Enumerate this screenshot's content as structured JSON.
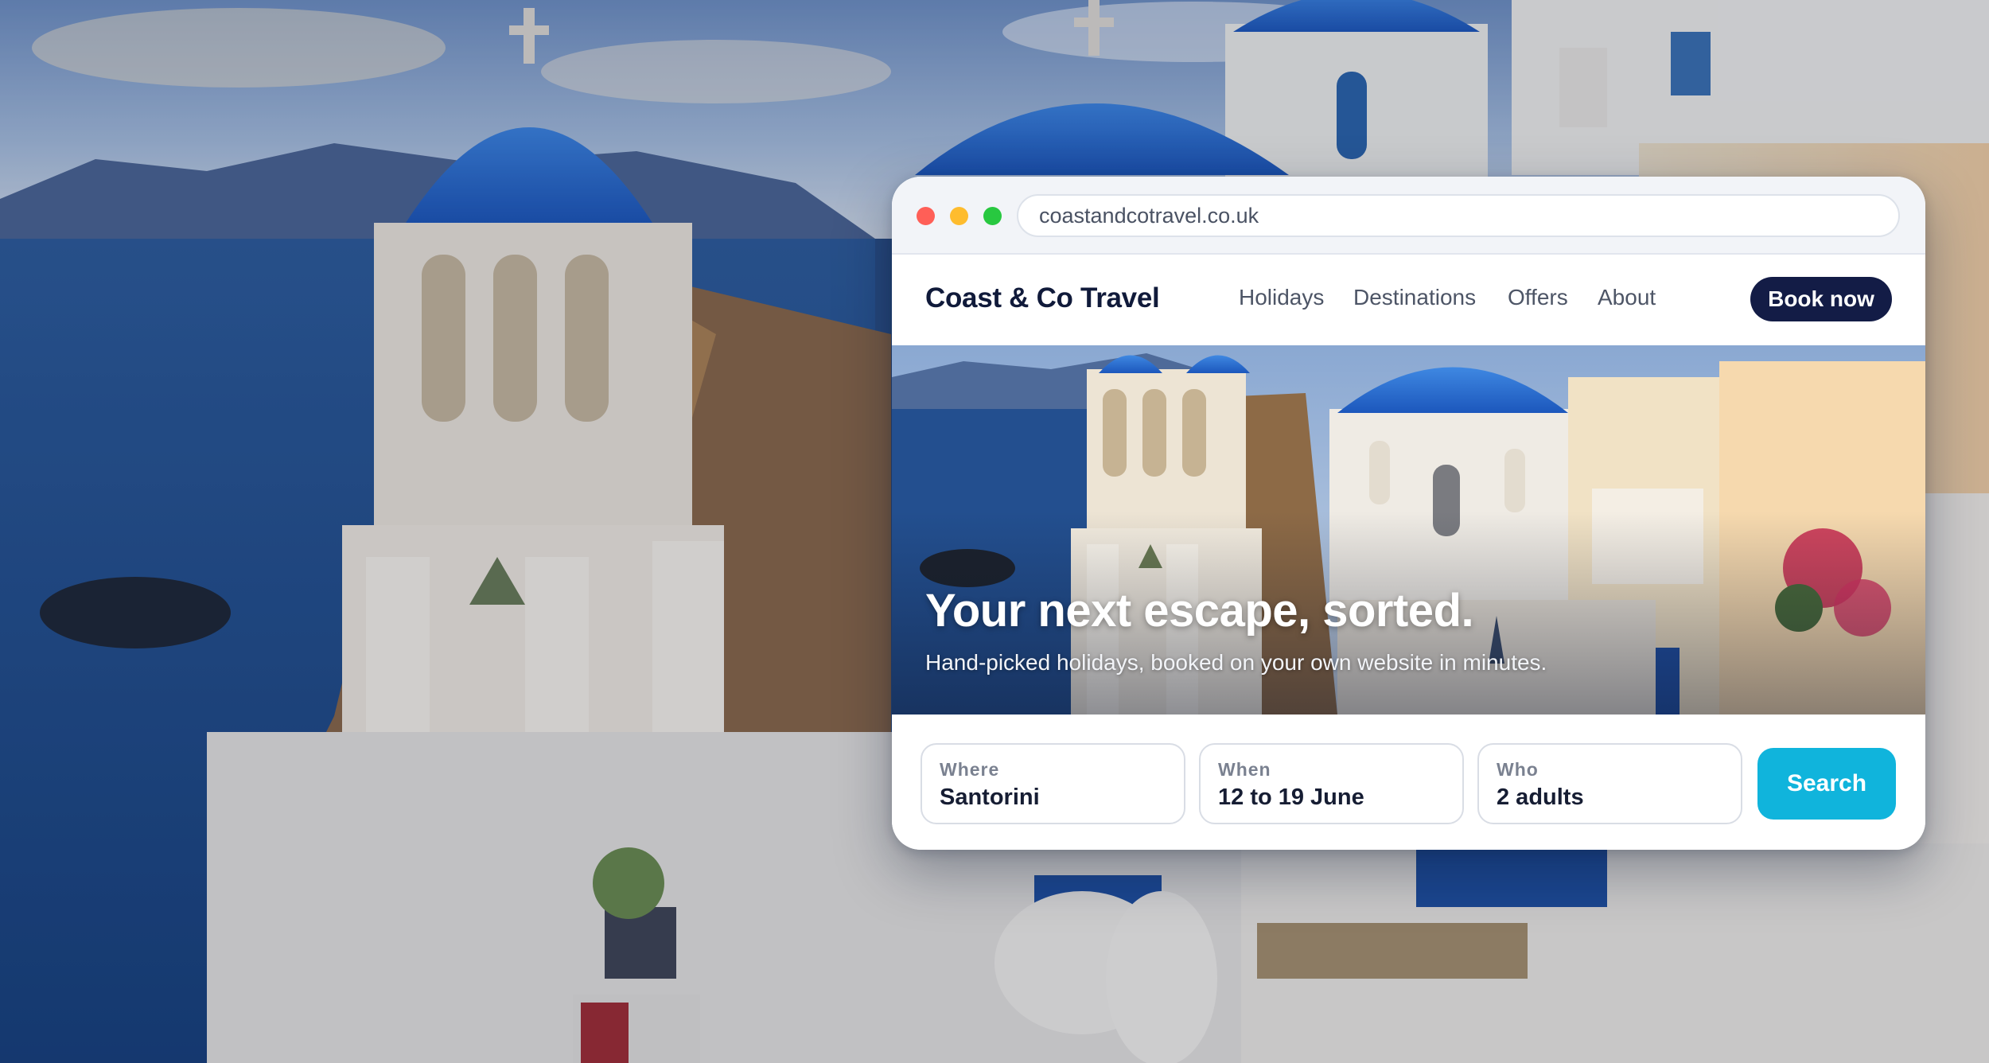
{
  "browser": {
    "address": "coastandcotravel.co.uk"
  },
  "nav": {
    "brand": "Coast & Co Travel",
    "links": [
      "Holidays",
      "Destinations",
      "Offers",
      "About"
    ],
    "cta": "Book now"
  },
  "hero": {
    "title": "Your next escape, sorted.",
    "subtitle": "Hand-picked holidays, booked on your own website in minutes."
  },
  "search": {
    "fields": [
      {
        "label": "Where",
        "value": "Santorini"
      },
      {
        "label": "When",
        "value": "12 to 19 June"
      },
      {
        "label": "Who",
        "value": "2 adults"
      }
    ],
    "button": "Search"
  },
  "colors": {
    "brand_navy": "#131c46",
    "accent_cyan": "#10b4dc",
    "dome_blue": "#1f5fc0"
  }
}
